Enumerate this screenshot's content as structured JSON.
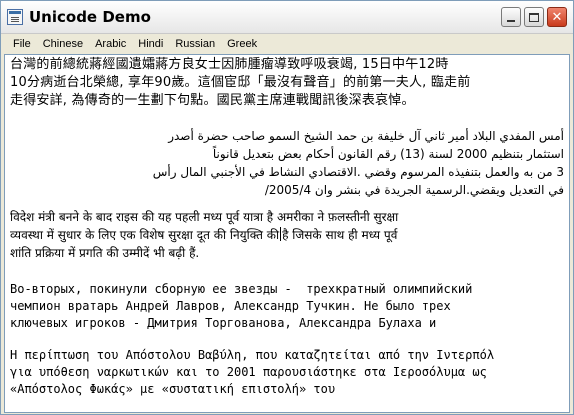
{
  "window": {
    "title": "Unicode Demo",
    "icon": "document-icon"
  },
  "menu": [
    "File",
    "Chinese",
    "Arabic",
    "Hindi",
    "Russian",
    "Greek"
  ],
  "content": {
    "chinese": [
      "台灣的前總統蔣經國遺孀蔣方良女士因肺腫瘤導致呼吸衰竭, 15日中午12時",
      "10分病逝台北榮總, 享年90歲。這個宦邸「最沒有聲音」的前第一夫人, 臨走前",
      "走得安詳, 為傳奇的一生劃下句點。國民黨主席連戰聞訊後深表哀悼。"
    ],
    "arabic": [
      "أمس المفدي البلاد أمير ثاني آل خليفة بن حمد الشيخ السمو صاحب حضرة أصدر",
      "استثمار بتنظيم 2000 لسنة (13) رقم القانون أحكام بعض بتعديل قانوناً",
      "3 من به والعمل بتنفيذه المرسوم وقضي .الاقتصادي النشاط في الأجنبي المال رأس",
      "في التعديل ويقضي.الرسمية الجريدة في بنشر وان 2005/4/"
    ],
    "hindi": [
      "विदेश मंत्री बनने के बाद राइस की यह पहली मध्य पूर्व यात्रा है अमरीका ने फ़लस्तीनी सुरक्षा",
      "व्यवस्था में सुधार के लिए एक विशेष सुरक्षा दूत की नियुक्ति की",
      "है जिसके साथ ही मध्य पूर्व",
      "शांति प्रक्रिया में प्रगति की उम्मीदें भी बढ़ी हैं."
    ],
    "russian": [
      "Во-вторых, покинули сборную ее звезды -  трехкратный олимпийский",
      "чемпион вратарь Андрей Лавров, Александр Тучкин. Не было трех",
      "ключевых игроков - Дмитрия Торгованова, Александра Булаха и"
    ],
    "greek": [
      "Η περίπτωση του Απόστολου Βαβύλη, που καταζητείται από την Ιντερπόλ",
      "για υπόθεση ναρκωτικών και το 2001 παρουσιάστηκε στα Ιεροσόλυμα ως",
      "«Απόστολος Φωκάς» με «συστατική επιστολή» του"
    ]
  }
}
